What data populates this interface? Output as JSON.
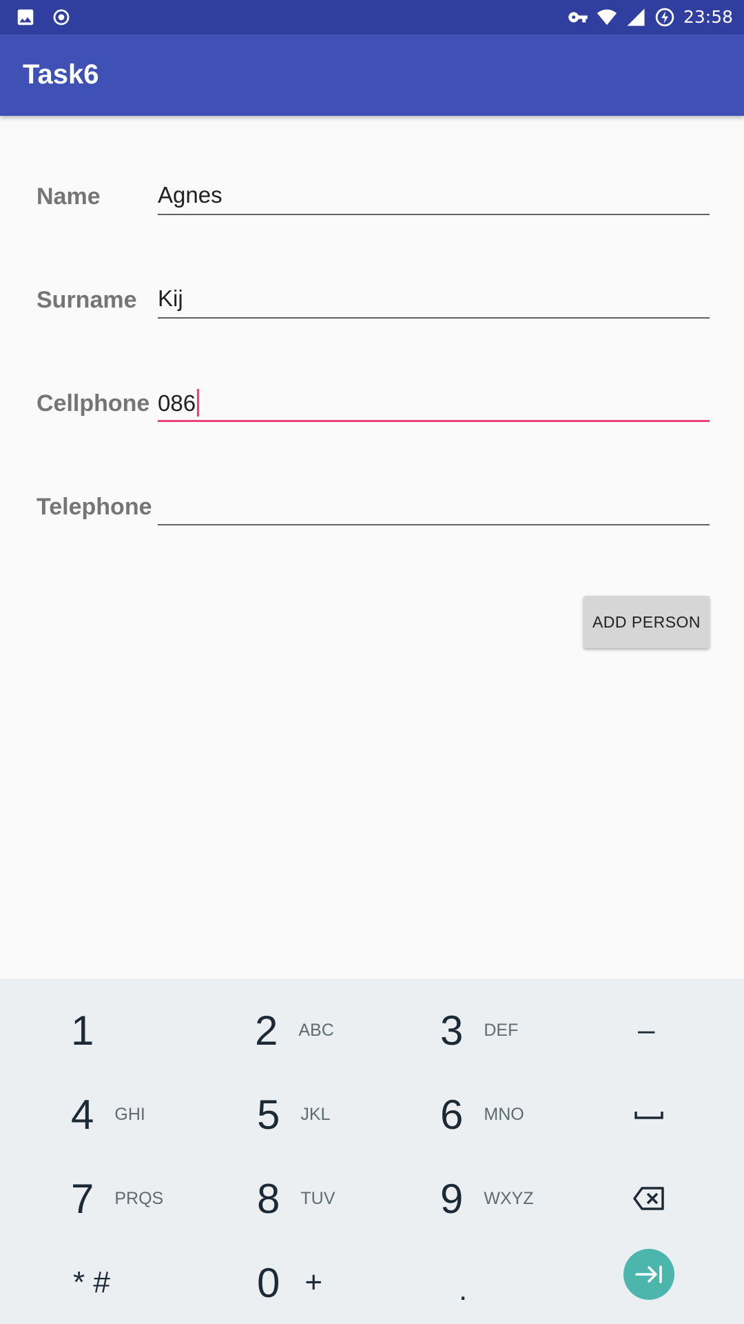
{
  "status_bar": {
    "time": "23:58",
    "left_icons": [
      "image-icon",
      "record-icon"
    ],
    "right_icons": [
      "vpn-key-icon",
      "wifi-icon",
      "signal-icon",
      "battery-charging-icon"
    ]
  },
  "app_bar": {
    "title": "Task6"
  },
  "form": {
    "name": {
      "label": "Name",
      "value": "Agnes"
    },
    "surname": {
      "label": "Surname",
      "value": "Kij"
    },
    "cellphone": {
      "label": "Cellphone",
      "value": "086"
    },
    "telephone": {
      "label": "Telephone",
      "value": ""
    }
  },
  "add_button_label": "ADD PERSON",
  "keyboard": {
    "k1": {
      "num": "1",
      "sub": ""
    },
    "k2": {
      "num": "2",
      "sub": "ABC"
    },
    "k3": {
      "num": "3",
      "sub": "DEF"
    },
    "k4": {
      "num": "4",
      "sub": "GHI"
    },
    "k5": {
      "num": "5",
      "sub": "JKL"
    },
    "k6": {
      "num": "6",
      "sub": "MNO"
    },
    "k7": {
      "num": "7",
      "sub": "PRQS"
    },
    "k8": {
      "num": "8",
      "sub": "TUV"
    },
    "k9": {
      "num": "9",
      "sub": "WXYZ"
    },
    "k0": {
      "num": "0",
      "sub": "+"
    },
    "star_hash": "* #",
    "dot": ".",
    "dash": "–",
    "icons": [
      "space-icon",
      "backspace-icon",
      "next-icon"
    ]
  },
  "colors": {
    "status_bar": "#303f9f",
    "app_bar": "#3f51b5",
    "accent": "#ec407a",
    "go_button": "#4db6ac"
  }
}
